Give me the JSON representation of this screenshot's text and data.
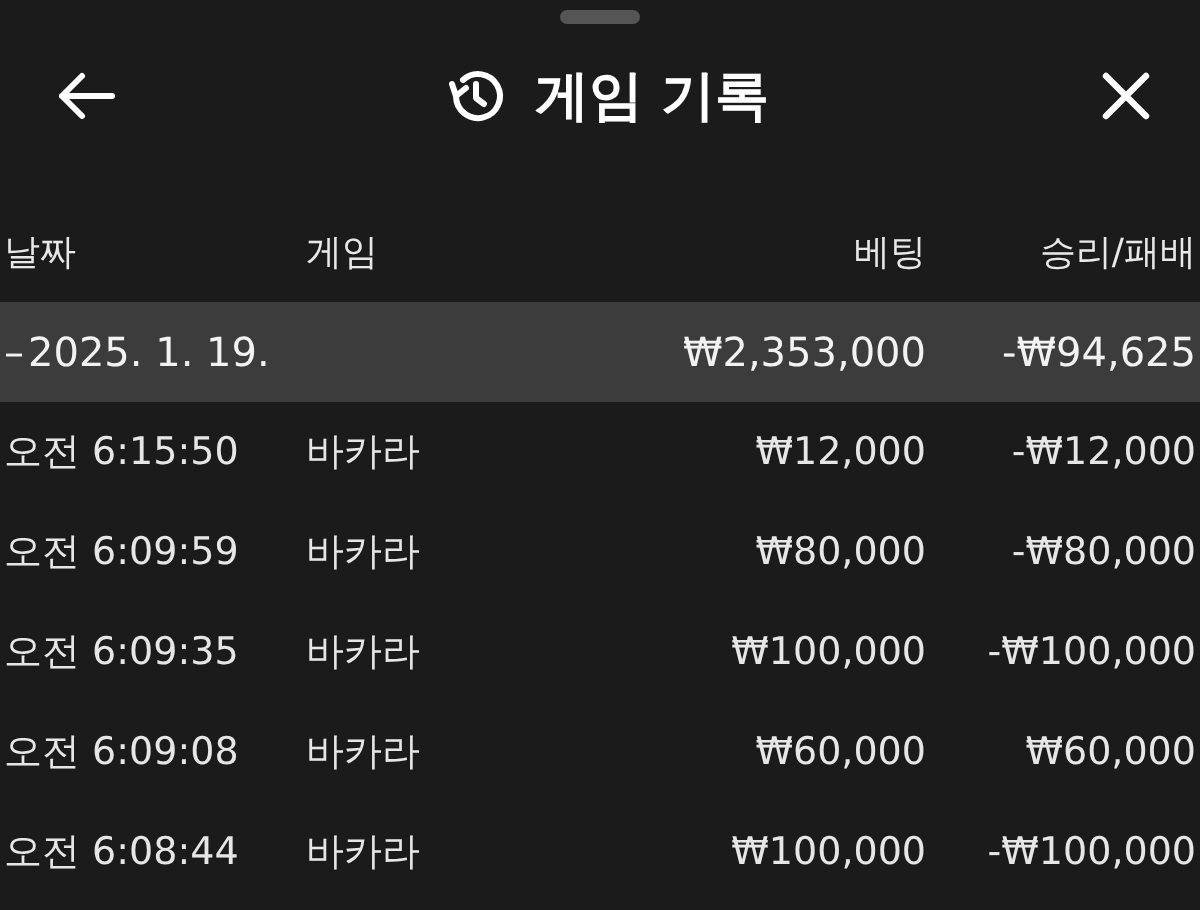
{
  "header": {
    "title": "게임 기록"
  },
  "table": {
    "columns": [
      "날짜",
      "게임",
      "베팅",
      "승리/패배"
    ],
    "group": {
      "toggle": "–",
      "date": "2025. 1. 19.",
      "bet_total": "₩2,353,000",
      "result_total": "-₩94,625"
    },
    "rows": [
      {
        "time": "오전 6:15:50",
        "game": "바카라",
        "bet": "₩12,000",
        "result": "-₩12,000"
      },
      {
        "time": "오전 6:09:59",
        "game": "바카라",
        "bet": "₩80,000",
        "result": "-₩80,000"
      },
      {
        "time": "오전 6:09:35",
        "game": "바카라",
        "bet": "₩100,000",
        "result": "-₩100,000"
      },
      {
        "time": "오전 6:09:08",
        "game": "바카라",
        "bet": "₩60,000",
        "result": "₩60,000"
      },
      {
        "time": "오전 6:08:44",
        "game": "바카라",
        "bet": "₩100,000",
        "result": "-₩100,000"
      }
    ]
  }
}
